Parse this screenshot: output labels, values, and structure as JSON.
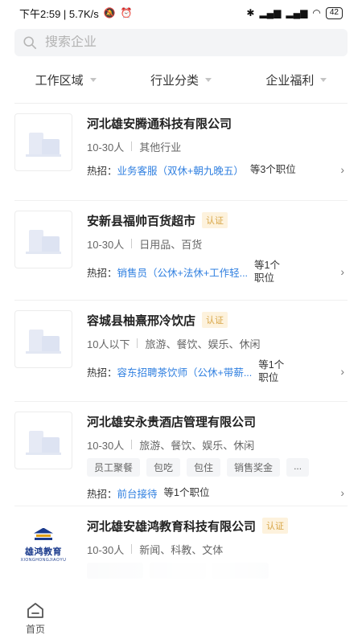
{
  "status_bar": {
    "time_speed": "下午2:59 | 5.7K/s",
    "battery": "42"
  },
  "search": {
    "placeholder": "搜索企业"
  },
  "filters": [
    "工作区域",
    "行业分类",
    "企业福利"
  ],
  "companies": [
    {
      "name": "河北雄安腾通科技有限公司",
      "verified": "",
      "size": "10-30人",
      "industry": "其他行业",
      "tags": [],
      "hot_label": "热招：",
      "job": "业务客服（双休+朝九晚五）",
      "count": "等3个职位"
    },
    {
      "name": "安新县福帅百货超市",
      "verified": "认证",
      "size": "10-30人",
      "industry": "日用品、百货",
      "tags": [],
      "hot_label": "热招：",
      "job": "销售员（公休+法休+工作轻...",
      "count": "等1个职位"
    },
    {
      "name": "容城县柚熹邢冷饮店",
      "verified": "认证",
      "size": "10人以下",
      "industry": "旅游、餐饮、娱乐、休闲",
      "tags": [],
      "hot_label": "热招：",
      "job": "容东招聘茶饮师（公休+带薪...",
      "count": "等1个职位"
    },
    {
      "name": "河北雄安永贵酒店管理有限公司",
      "verified": "",
      "size": "10-30人",
      "industry": "旅游、餐饮、娱乐、休闲",
      "tags": [
        "员工聚餐",
        "包吃",
        "包住",
        "销售奖金",
        "..."
      ],
      "hot_label": "热招：",
      "job": "前台接待",
      "count": "等1个职位"
    },
    {
      "name": "河北雄安雄鸿教育科技有限公司",
      "verified": "认证",
      "size": "10-30人",
      "industry": "新闻、科教、文体",
      "logo_text": "雄鸿教育",
      "logo_sub": "XIONGHONGJIAOYU"
    }
  ],
  "bottom_nav": {
    "home_label": "首页"
  }
}
